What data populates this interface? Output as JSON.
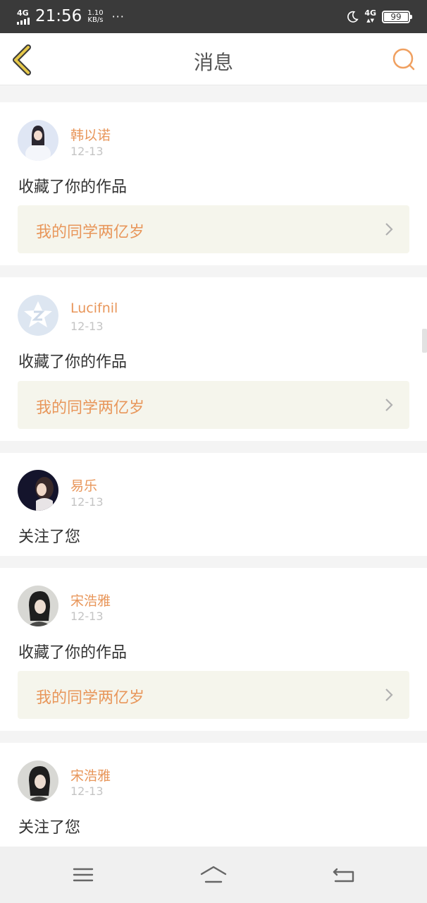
{
  "status_bar": {
    "network": "4G",
    "time": "21:56",
    "speed_value": "1.10",
    "speed_unit": "KB/s",
    "more": "···",
    "network_right": "4G",
    "battery": "99"
  },
  "header": {
    "title": "消息",
    "icons": {
      "back": "back-arrow-icon",
      "search": "search-icon"
    },
    "accent_color": "#e8965a"
  },
  "messages": [
    {
      "name": "韩以诺",
      "date": "12-13",
      "action": "收藏了你的作品",
      "work_title": "我的同学两亿岁"
    },
    {
      "name": "Lucifnil",
      "date": "12-13",
      "action": "收藏了你的作品",
      "work_title": "我的同学两亿岁"
    },
    {
      "name": "易乐",
      "date": "12-13",
      "action": "关注了您"
    },
    {
      "name": "宋浩雅",
      "date": "12-13",
      "action": "收藏了你的作品",
      "work_title": "我的同学两亿岁"
    },
    {
      "name": "宋浩雅",
      "date": "12-13",
      "action": "关注了您"
    }
  ],
  "nav_bar": {
    "icons": [
      "menu-icon",
      "home-icon",
      "back-icon"
    ]
  }
}
